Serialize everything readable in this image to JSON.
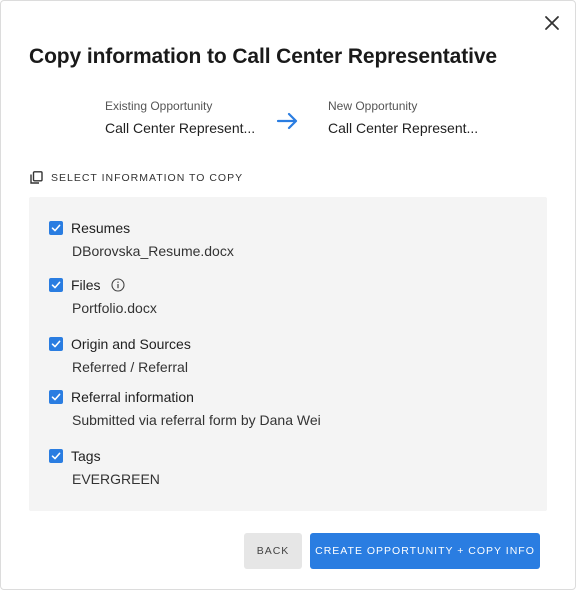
{
  "dialog": {
    "title": "Copy information to Call Center Representative",
    "close_icon": "close-icon"
  },
  "existing": {
    "label": "Existing Opportunity",
    "value": "Call Center Represent..."
  },
  "new": {
    "label": "New Opportunity",
    "value": "Call Center Represent..."
  },
  "section": {
    "heading": "SELECT INFORMATION TO COPY",
    "icon": "copy-icon"
  },
  "items": [
    {
      "title": "Resumes",
      "sub": "DBorovska_Resume.docx",
      "checked": true
    },
    {
      "title": "Files",
      "sub": "Portfolio.docx",
      "checked": true,
      "info_icon": "info-icon"
    },
    {
      "title": "Origin and Sources",
      "sub": "Referred / Referral",
      "checked": true
    },
    {
      "title": "Referral information",
      "sub": "Submitted via referral form by Dana Wei",
      "checked": true
    },
    {
      "title": "Tags",
      "sub": "EVERGREEN",
      "checked": true
    }
  ],
  "buttons": {
    "back": "BACK",
    "create": "CREATE OPPORTUNITY + COPY INFO"
  },
  "colors": {
    "accent": "#2a7de1",
    "panel": "#f4f4f4",
    "back_button": "#e6e6e6"
  }
}
